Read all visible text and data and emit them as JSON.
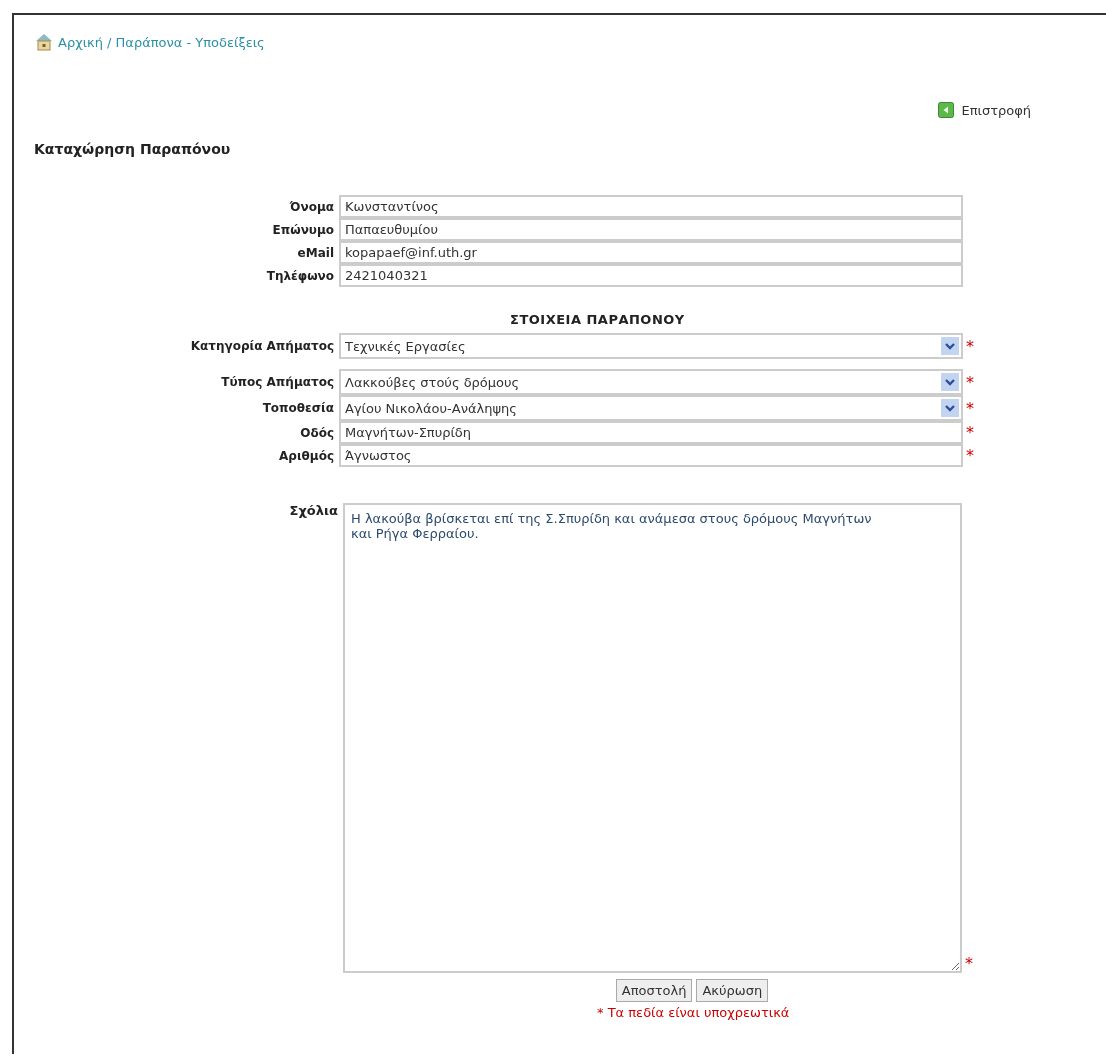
{
  "breadcrumb": "Αρχική / Παράπονα - Υποδείξεις",
  "back_link": "Επιστροφή",
  "heading": "Καταχώρηση Παραπόνου",
  "personal_fields": [
    {
      "label": "Όνομα",
      "kind": "text",
      "value": "Κωνσταντίνος"
    },
    {
      "label": "Επώνυμο",
      "kind": "text",
      "value": "Παπαευθυμίου"
    },
    {
      "label": "eMail",
      "kind": "text",
      "value": "kopapaef@inf.uth.gr"
    },
    {
      "label": "Τηλέφωνο",
      "kind": "text",
      "value": "2421040321"
    }
  ],
  "section_title": "ΣΤΟΙΧΕΙΑ ΠΑΡΑΠΟΝΟΥ",
  "complaint_fields": [
    {
      "label": "Κατηγορία Απήματος",
      "kind": "select",
      "value": "Τεχνικές Εργασίες",
      "required_mark": "*"
    },
    {
      "label": "Τύπος Απήματος",
      "kind": "select",
      "value": "Λακκούβες στούς δρόμους",
      "required_mark": "*"
    },
    {
      "label": "Τοποθεσία",
      "kind": "select",
      "value": "Αγίου Νικολάου-Ανάληψης",
      "required_mark": "*"
    },
    {
      "label": "Οδός",
      "kind": "text",
      "value": "Μαγνήτων-Σπυρίδη",
      "required_mark": "*"
    },
    {
      "label": "Αριθμός",
      "kind": "text",
      "value": "Άγνωστος",
      "required_mark": "*"
    }
  ],
  "comments": {
    "label": "Σχόλια",
    "value": "Η λακούβα βρίσκεται επί της Σ.Σπυρίδη και ανάμεσα στους δρόμους Μαγνήτων και Ρήγα Φερραίου.",
    "required_mark": "*"
  },
  "buttons": [
    "Αποστολή",
    "Ακύρωση"
  ],
  "required_note": "* Τα πεδία είναι υποχρεωτικά"
}
